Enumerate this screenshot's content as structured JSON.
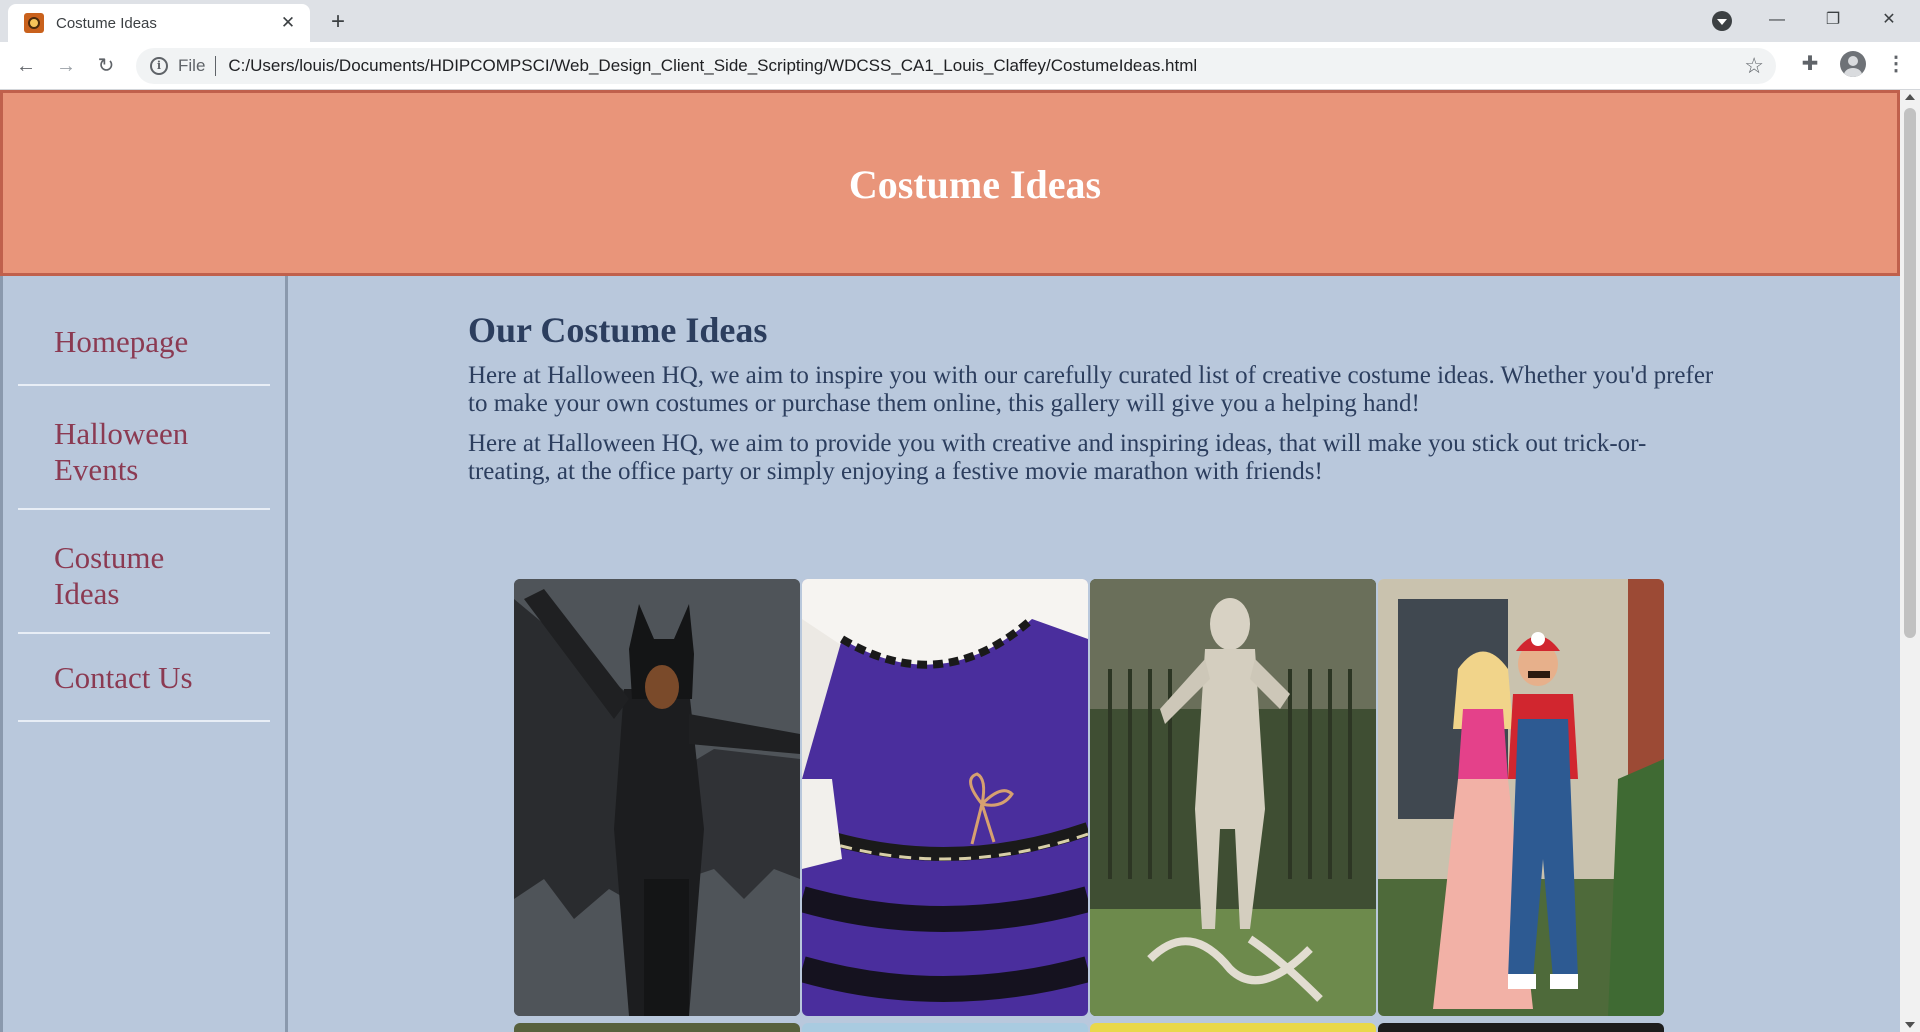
{
  "browser": {
    "tab_title": "Costume Ideas",
    "new_tab_label": "+",
    "scheme_label": "File",
    "url": "C:/Users/louis/Documents/HDIPCOMPSCI/Web_Design_Client_Side_Scripting/WDCSS_CA1_Louis_Claffey/CostumeIdeas.html",
    "icons": [
      "back-icon",
      "forward-icon",
      "reload-icon",
      "info-icon",
      "star-icon",
      "extensions-icon",
      "profile-icon",
      "menu-icon",
      "minimize-icon",
      "maximize-icon",
      "close-icon"
    ]
  },
  "header": {
    "title": "Costume Ideas"
  },
  "sidebar": {
    "items": [
      {
        "line1": "Homepage",
        "line2": ""
      },
      {
        "line1": "Halloween",
        "line2": "Events"
      },
      {
        "line1": "Costume",
        "line2": "Ideas"
      },
      {
        "line1": "Contact Us",
        "line2": ""
      }
    ]
  },
  "main": {
    "title": "Our Costume Ideas",
    "paragraphs": [
      "Here at Halloween HQ, we aim to inspire you with our carefully curated list of creative costume ideas. Whether you'd prefer to make your own costumes or purchase them online, this gallery will give you a helping hand!",
      "Here at Halloween HQ, we aim to provide you with creative and inspiring ideas, that will make you stick out trick-or-treating, at the office party or simply enjoying a festive movie marathon with friends!"
    ]
  },
  "gallery": {
    "photos": [
      "bat-costume-photo",
      "purple-knit-dress-photo",
      "mummy-costume-photo",
      "mario-peach-costume-photo"
    ]
  },
  "colors": {
    "header_bg": "#e9957a",
    "page_bg": "#b9c8dc",
    "nav_link": "#8b3a52",
    "heading": "#2c3e5e"
  }
}
